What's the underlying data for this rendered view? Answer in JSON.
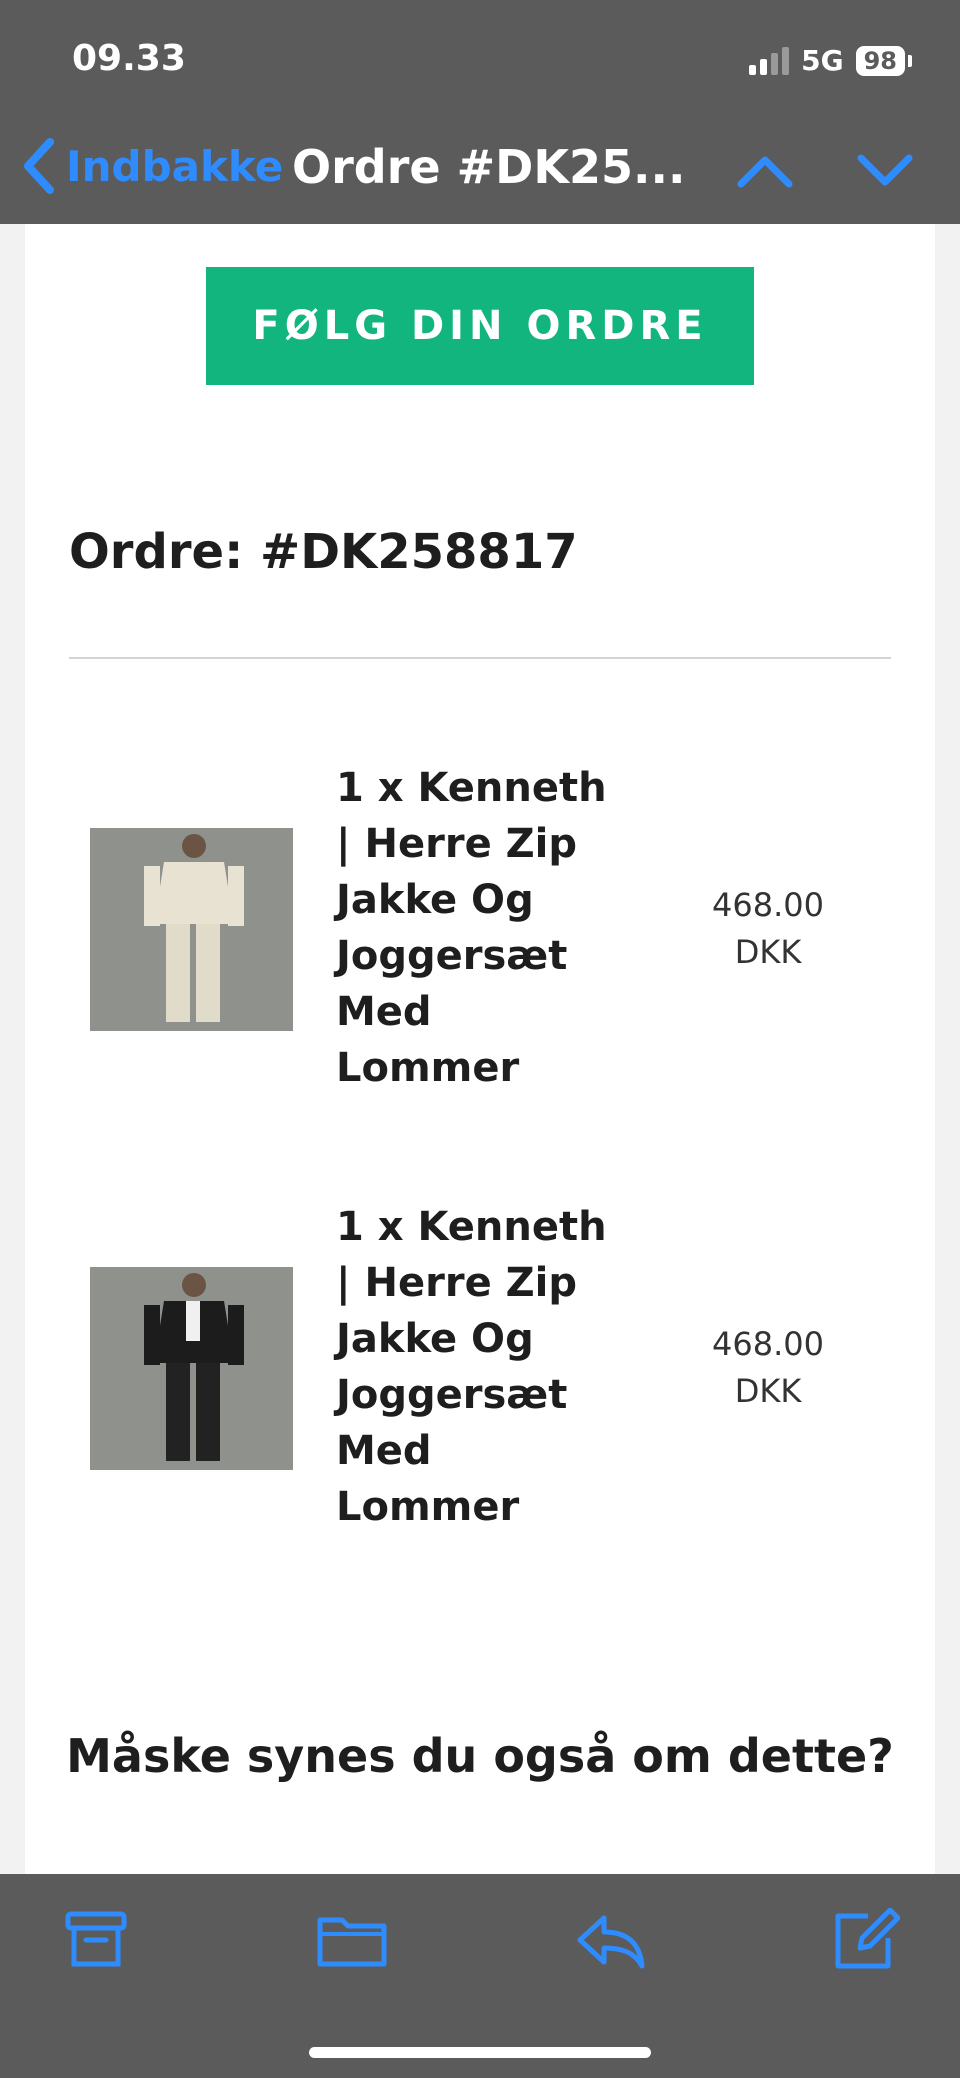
{
  "status_bar": {
    "time": "09.33",
    "network": "5G",
    "battery": "98"
  },
  "nav": {
    "back_label": "Indbakke",
    "title": "Ordre #DK25..."
  },
  "email": {
    "cta_label": "FØLG DIN ORDRE",
    "order_heading": "Ordre: #DK258817",
    "items": [
      {
        "name_lines": [
          "1 x Kenneth",
          "| Herre Zip",
          "Jakke Og",
          "Joggersæt",
          "Med",
          "Lommer"
        ],
        "price_amount": "468.00",
        "price_currency": "DKK",
        "outfit_color": "#e8e2d2"
      },
      {
        "name_lines": [
          "1 x Kenneth",
          "| Herre Zip",
          "Jakke Og",
          "Joggersæt",
          "Med",
          "Lommer"
        ],
        "price_amount": "468.00",
        "price_currency": "DKK",
        "outfit_color": "#1c1c1c"
      }
    ],
    "suggest_heading": "Måske synes du også om dette?"
  },
  "toolbar": {
    "icons": [
      "archive-icon",
      "folder-icon",
      "reply-icon",
      "compose-icon"
    ]
  },
  "colors": {
    "accent_blue": "#2f8cff",
    "cta_green": "#12b57e",
    "chrome_gray": "#5b5b5b"
  }
}
